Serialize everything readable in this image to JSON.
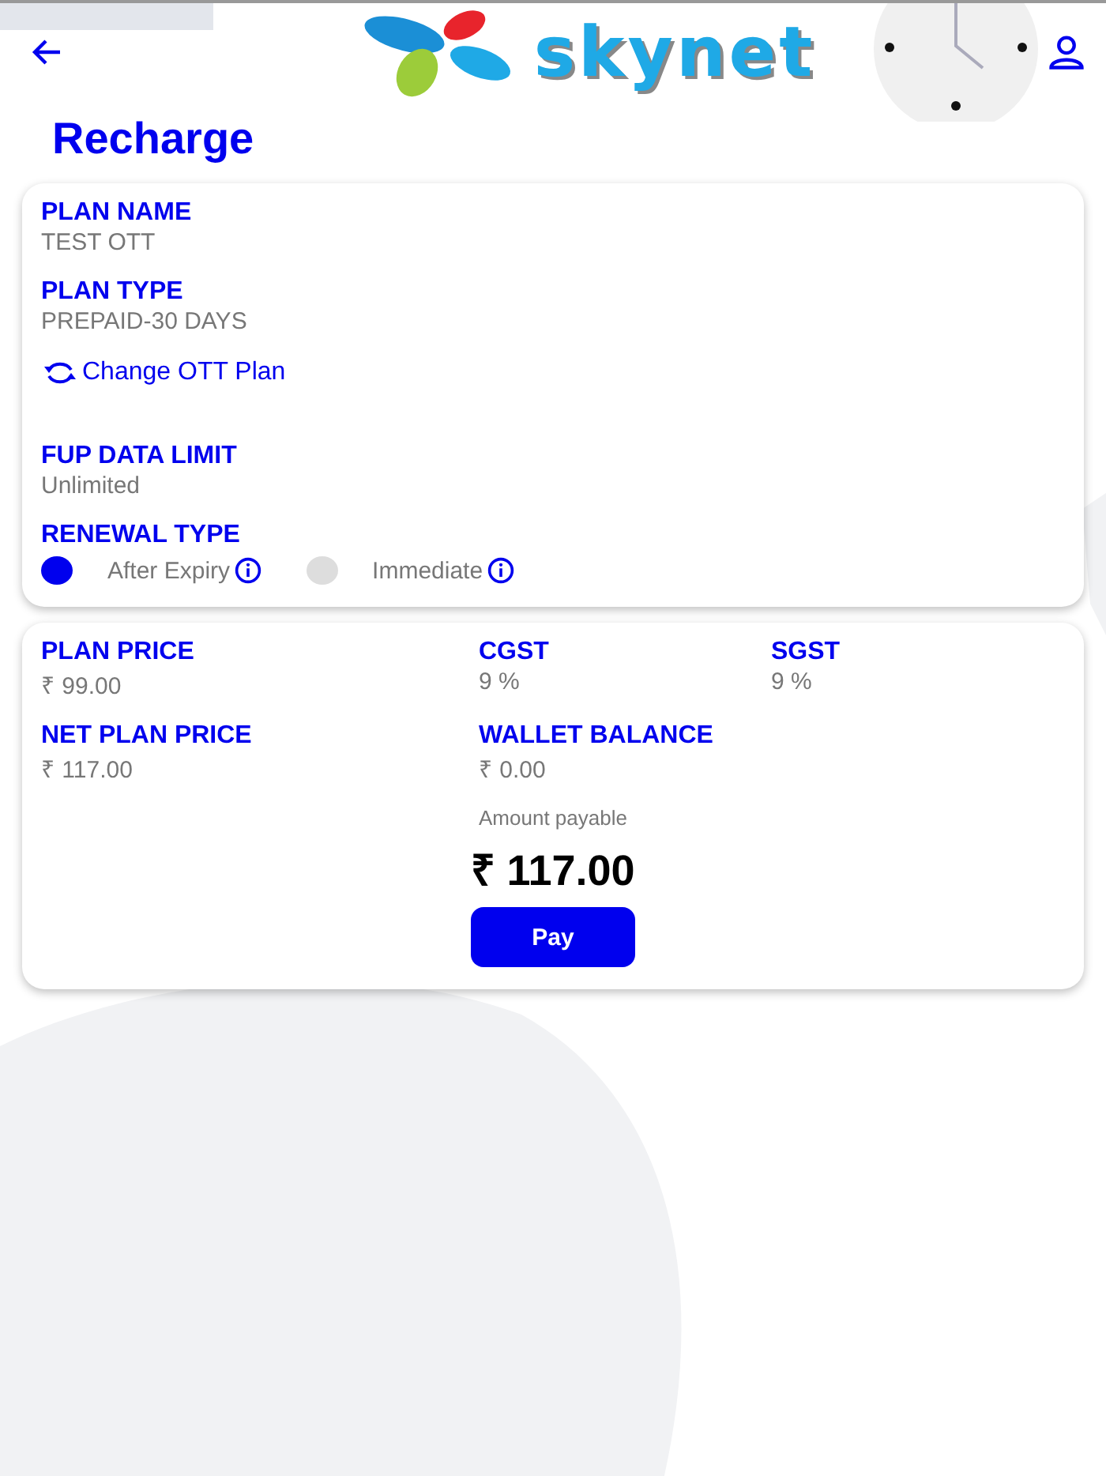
{
  "header": {
    "logo_text": "skynet"
  },
  "title": "Recharge",
  "plan_card": {
    "fields": [
      {
        "label": "PLAN NAME",
        "value": "TEST OTT"
      },
      {
        "label": "PLAN TYPE",
        "value": "PREPAID-30 DAYS"
      }
    ],
    "change_link": "Change OTT Plan",
    "fup": {
      "label": "FUP DATA LIMIT",
      "value": "Unlimited"
    },
    "renewal": {
      "label": "RENEWAL TYPE",
      "options": [
        {
          "label": "After Expiry",
          "selected": true
        },
        {
          "label": "Immediate",
          "selected": false
        }
      ]
    }
  },
  "price_card": {
    "fields": [
      {
        "label": "PLAN PRICE",
        "value": "₹ 99.00"
      },
      {
        "label": "CGST",
        "value": "9 %"
      },
      {
        "label": "SGST",
        "value": "9 %"
      },
      {
        "label": "NET PLAN PRICE",
        "value": "₹ 117.00"
      },
      {
        "label": "WALLET BALANCE",
        "value": "₹ 0.00"
      }
    ],
    "amount_label": "Amount payable",
    "amount": "₹ 117.00",
    "pay_button": "Pay"
  }
}
